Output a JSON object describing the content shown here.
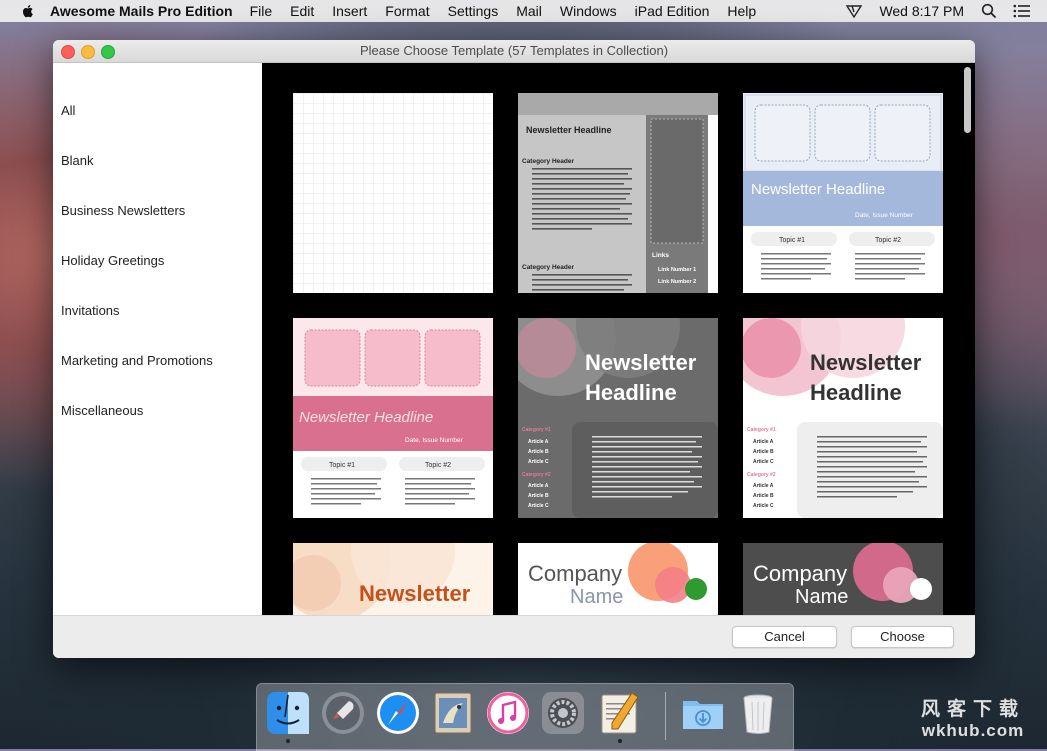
{
  "menubar": {
    "app_name": "Awesome Mails Pro Edition",
    "items": [
      "File",
      "Edit",
      "Insert",
      "Format",
      "Settings",
      "Mail",
      "Windows",
      "iPad Edition",
      "Help"
    ],
    "clock": "Wed 8:17 PM"
  },
  "window": {
    "title": "Please Choose Template (57 Templates in Collection)"
  },
  "sidebar": {
    "categories": [
      "All",
      "Blank",
      "Business Newsletters",
      "Holiday Greetings",
      "Invitations",
      "Marketing and Promotions",
      "Miscellaneous"
    ]
  },
  "templates": {
    "headline": "Newsletter Headline",
    "category_header": "Category Header",
    "links": "Links",
    "link_items": [
      "Link Number 1",
      "Link Number 2"
    ],
    "date_line": "Date, Issue Number",
    "topics": [
      "Topic #1",
      "Topic #2"
    ],
    "dark_categories": [
      "Category #1",
      "Category #2"
    ],
    "articles": [
      "Article A",
      "Article B",
      "Article C"
    ],
    "company": [
      "Company",
      "Name"
    ],
    "script_headline": "Newsletter Headline",
    "headline_lines": [
      "Newsletter",
      "Headline"
    ]
  },
  "buttons": {
    "cancel": "Cancel",
    "choose": "Choose"
  },
  "dock": {
    "apps": [
      "finder-icon",
      "launchpad-icon",
      "safari-icon",
      "mail-icon",
      "itunes-icon",
      "system-preferences-icon",
      "awesome-mails-icon",
      "downloads-folder-icon",
      "trash-icon"
    ]
  },
  "watermark": {
    "line1": "风客下载",
    "line2": "wkhub.com"
  },
  "colors": {
    "pink_accent": "#e47a97",
    "pink_headline_band": "#d9708f",
    "blue_headline_band": "#a4b8dc",
    "orange_headline": "#c2521b",
    "dark_gray": "#6b6b6b"
  }
}
